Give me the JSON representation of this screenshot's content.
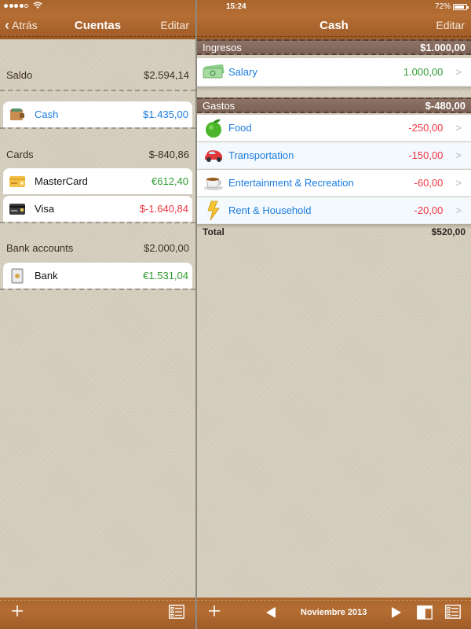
{
  "status_bar": {
    "time": "15:24",
    "battery_percent_label": "72%",
    "battery_level": 0.72,
    "signal_bars_filled": 4,
    "signal_bars_total": 5,
    "wifi_icon": "wifi-icon"
  },
  "left_panel": {
    "nav": {
      "back_label": "Atrás",
      "title": "Cuentas",
      "edit_label": "Editar"
    },
    "saldo": {
      "label": "Saldo",
      "amount": "$2.594,14"
    },
    "groups": [
      {
        "label": "",
        "accounts": [
          {
            "name": "Cash",
            "amount": "$1.435,00",
            "icon": "wallet-icon",
            "amount_color": "blue",
            "selected": true
          }
        ]
      },
      {
        "label": "Cards",
        "total": "$-840,86",
        "accounts": [
          {
            "name": "MasterCard",
            "amount": "€612,40",
            "icon": "gold-card-icon",
            "amount_color": "green"
          },
          {
            "name": "Visa",
            "amount": "$-1.640,84",
            "icon": "dark-card-icon",
            "amount_color": "red"
          }
        ]
      },
      {
        "label": "Bank accounts",
        "total": "$2.000,00",
        "accounts": [
          {
            "name": "Bank",
            "amount": "€1.531,04",
            "icon": "safe-icon",
            "amount_color": "green"
          }
        ]
      }
    ],
    "toolbar": {
      "add_icon": "plus-icon",
      "list_icon": "list-icon"
    }
  },
  "right_panel": {
    "nav": {
      "title": "Cash",
      "edit_label": "Editar"
    },
    "income": {
      "label": "Ingresos",
      "total": "$1.000,00",
      "items": [
        {
          "name": "Salary",
          "amount": "1.000,00",
          "icon": "money-icon"
        }
      ]
    },
    "expenses": {
      "label": "Gastos",
      "total": "$-480,00",
      "items": [
        {
          "name": "Food",
          "amount": "-250,00",
          "icon": "apple-icon"
        },
        {
          "name": "Transportation",
          "amount": "-150,00",
          "icon": "car-icon"
        },
        {
          "name": "Entertainment & Recreation",
          "amount": "-60,00",
          "icon": "coffee-cup-icon"
        },
        {
          "name": "Rent & Household",
          "amount": "-20,00",
          "icon": "lightning-icon"
        }
      ]
    },
    "total": {
      "label": "Total",
      "amount": "$520,00"
    },
    "toolbar": {
      "period_label": "Noviembre 2013",
      "add_icon": "plus-icon",
      "prev_icon": "triangle-left-icon",
      "next_icon": "triangle-right-icon",
      "layout_icon": "panel-layout-icon",
      "list_icon": "list-icon"
    }
  },
  "colors": {
    "leather": "#a9652d",
    "canvas": "#d6cfbe",
    "section_header": "#8d7467",
    "link_blue": "#1a7de0",
    "positive_green": "#2e9b2e",
    "negative_red": "#f03540"
  }
}
